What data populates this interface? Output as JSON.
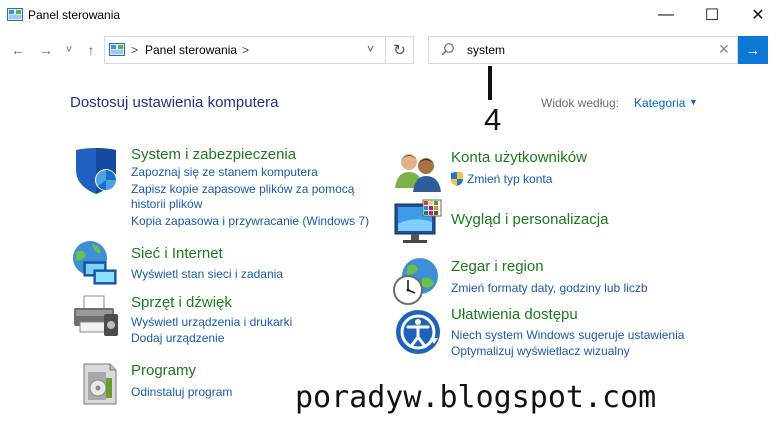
{
  "window": {
    "title": "Panel sterowania",
    "minimize": "—",
    "maximize": "☐",
    "close": "✕"
  },
  "nav": {
    "back": "←",
    "forward": "→",
    "recent": "˅",
    "up": "↑"
  },
  "address": {
    "sep1": ">",
    "location": "Panel sterowania",
    "sep2": ">",
    "dropdown": "˅",
    "refresh": "↻"
  },
  "search": {
    "value": "system",
    "clear": "✕",
    "go": "→"
  },
  "header": {
    "title": "Dostosuj ustawienia komputera",
    "view_by_label": "Widok według:",
    "view_by_value": "Kategoria",
    "view_by_caret": "▼"
  },
  "annotation": {
    "number": "4"
  },
  "categories_left": [
    {
      "title": "System i zabezpieczenia",
      "links": [
        "Zapoznaj się ze stanem komputera",
        "Zapisz kopie zapasowe plików za pomocą",
        "historii plików",
        "Kopia zapasowa i przywracanie (Windows 7)"
      ]
    },
    {
      "title": "Sieć i Internet",
      "links": [
        "Wyświetl stan sieci i zadania"
      ]
    },
    {
      "title": "Sprzęt i dźwięk",
      "links": [
        "Wyświetl urządzenia i drukarki",
        "Dodaj urządzenie"
      ]
    },
    {
      "title": "Programy",
      "links": [
        "Odinstaluj program"
      ]
    }
  ],
  "categories_right": [
    {
      "title": "Konta użytkowników",
      "links": [
        "Zmień typ konta"
      ]
    },
    {
      "title": "Wygląd i personalizacja",
      "links": []
    },
    {
      "title": "Zegar i region",
      "links": [
        "Zmień formaty daty, godziny lub liczb"
      ]
    },
    {
      "title": "Ułatwienia dostępu",
      "links": [
        "Niech system Windows sugeruje ustawienia",
        "Optymalizuj wyświetlacz wizualny"
      ]
    }
  ],
  "watermark": "poradyw.blogspot.com",
  "colors": {
    "category_title": "#1b7a1b",
    "link": "#1a5aa8",
    "heading": "#1e3287",
    "search_button": "#0a78d4"
  }
}
